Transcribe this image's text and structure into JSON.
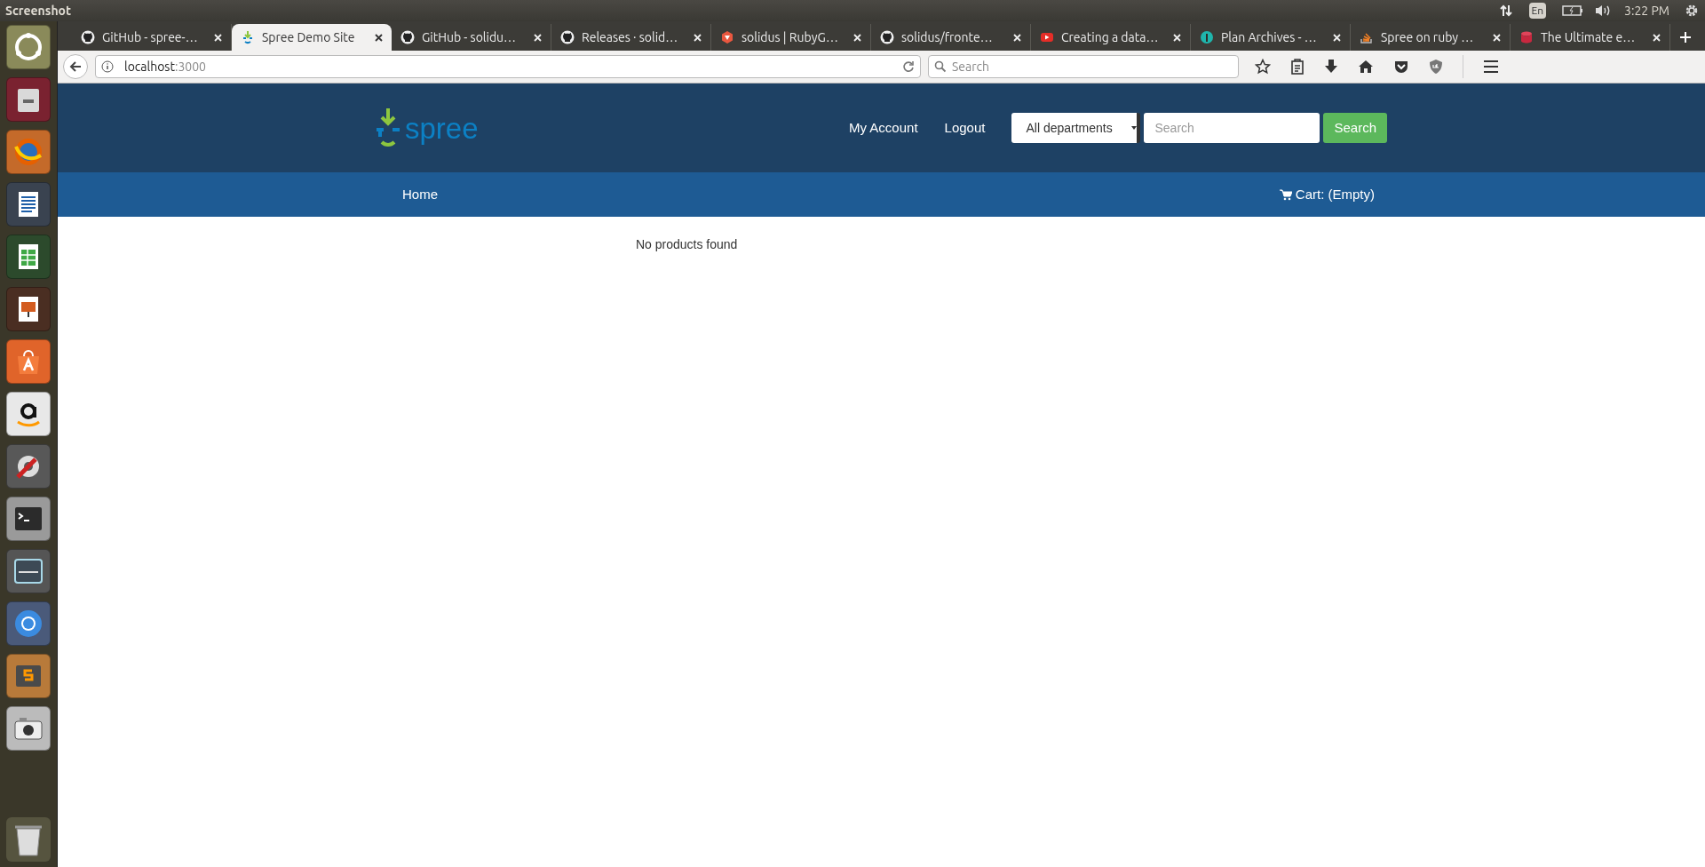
{
  "top_panel": {
    "title": "Screenshot",
    "keyboard": "En",
    "clock": "3:22 PM"
  },
  "tabs": [
    {
      "title": "GitHub - spree-…",
      "selected": false
    },
    {
      "title": "Spree Demo Site",
      "selected": true
    },
    {
      "title": "GitHub - solidu…",
      "selected": false
    },
    {
      "title": "Releases · solid…",
      "selected": false
    },
    {
      "title": "solidus | RubyG…",
      "selected": false
    },
    {
      "title": "solidus/fronte…",
      "selected": false
    },
    {
      "title": "Creating a data…",
      "selected": false
    },
    {
      "title": "Plan Archives - …",
      "selected": false
    },
    {
      "title": "Spree on ruby …",
      "selected": false
    },
    {
      "title": "The Ultimate e…",
      "selected": false
    }
  ],
  "address_bar": {
    "host": "localhost",
    "port": ":3000"
  },
  "browser_search": {
    "placeholder": "Search"
  },
  "site": {
    "logo_text": "spree",
    "links": [
      "My Account",
      "Logout"
    ],
    "department": "All departments",
    "search_placeholder": "Search",
    "search_button": "Search",
    "nav": [
      "Home"
    ],
    "cart": "Cart: (Empty)",
    "message": "No products found"
  }
}
